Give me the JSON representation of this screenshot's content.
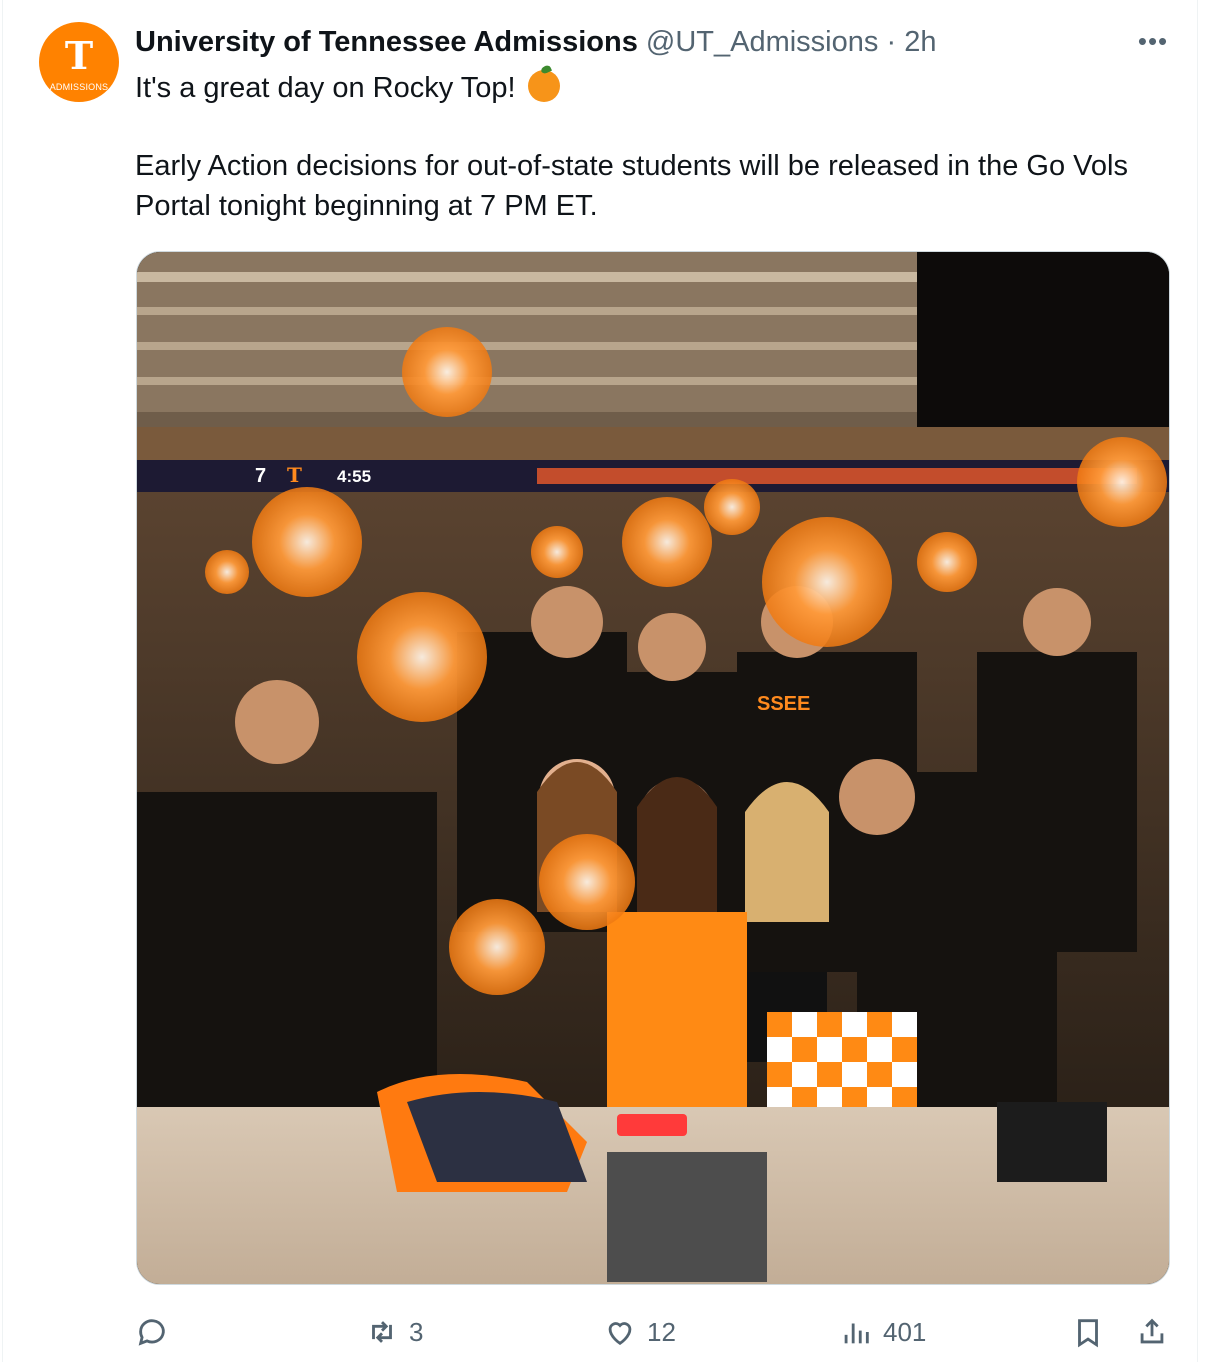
{
  "tweet": {
    "author_name": "University of Tennessee Admissions",
    "handle": "@UT_Admissions",
    "separator": "·",
    "time": "2h",
    "more_label": "•••",
    "avatar": {
      "letter": "T",
      "caption": "ADMISSIONS"
    },
    "text_line1": "It's a great day on Rocky Top!",
    "text_body": "Early Action decisions for out-of-state students will be released in the Go Vols Portal tonight beginning at 7 PM ET.",
    "emoji": "orange-emoji"
  },
  "photo": {
    "scoreboard": {
      "score_left": "7",
      "letter": "T",
      "clock": "4:55"
    },
    "shirt_text": "SSEE"
  },
  "actions": {
    "reply_count": "",
    "retweet_count": "3",
    "like_count": "12",
    "views_count": "401"
  },
  "colors": {
    "brand_orange": "#ff8200",
    "text_primary": "#0f1419",
    "text_secondary": "#536471",
    "border": "#cfd9de"
  }
}
